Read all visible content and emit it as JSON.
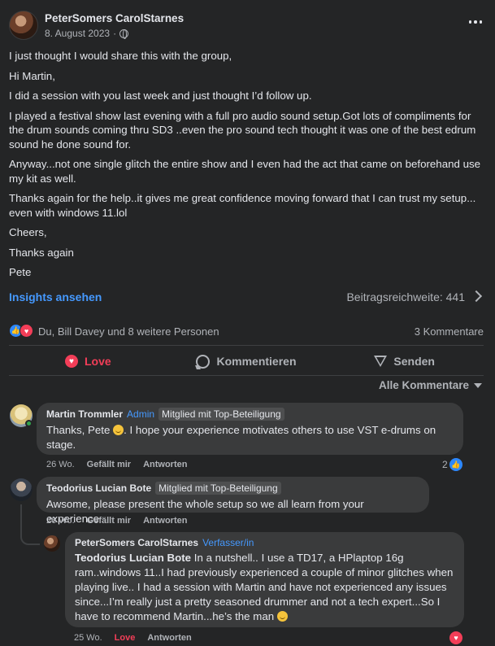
{
  "post": {
    "author": "PeterSomers CarolStarnes",
    "date": "8. August 2023",
    "date_sep": "·",
    "body": [
      "I just thought I would share this with the group,",
      "Hi Martin,",
      "I did a session with you last week and just thought I’d follow up.",
      "I played a festival show last evening with a full pro audio sound setup.Got lots of compliments for the drum sounds coming thru SD3 ..even the pro sound tech thought it was one of the best edrum sound he done sound for.",
      "Anyway...not one single glitch the entire show and I even had the act that came on beforehand use my kit as well.",
      "Thanks again for the help..it gives me great confidence moving forward that I can trust my setup... even with windows 11.lol",
      "Cheers,",
      "Thanks again",
      "Pete"
    ],
    "insights_label": "Insights ansehen",
    "reach_label": "Beitragsreichweite: 441",
    "reactions_text": "Du, Bill Davey und 8 weitere Personen",
    "comment_count": "3 Kommentare"
  },
  "actions": {
    "love": "Love",
    "comment": "Kommentieren",
    "send": "Senden"
  },
  "sort_label": "Alle Kommentare",
  "comments": [
    {
      "author": "Martin Trommler",
      "role": "Admin",
      "badge": "Mitglied mit Top-Beteiligung",
      "text_before": "Thanks, Pete",
      "text_after": ". I hope your experience motivates others to use VST e-drums on stage.",
      "time": "26 Wo.",
      "like": "Gefällt mir",
      "reply": "Antworten",
      "reaction_count": "2"
    },
    {
      "author": "Teodorius Lucian Bote",
      "badge": "Mitglied mit Top-Beteiligung",
      "text": "Awsome, please present the whole setup so we all learn from your experience",
      "time": "26 Wo.",
      "like": "Gefällt mir",
      "reply": "Antworten"
    },
    {
      "author": "PeterSomers CarolStarnes",
      "role": "Verfasser/in",
      "mention": "Teodorius Lucian Bote",
      "text": "In a nutshell.. I use a TD17, a HPlaptop 16g ram..windows 11..I had previously experienced a couple of minor glitches when playing live.. I had a session with Martin and have not experienced any issues since...I’m really just a pretty seasoned drummer and not a tech expert...So I have to recommend Martin...he’s the man",
      "time": "25 Wo.",
      "like": "Love",
      "reply": "Antworten"
    }
  ],
  "colors": {
    "background": "#242526",
    "bubble": "#3a3b3c",
    "accent_blue": "#4599ff",
    "love_red": "#f33e58"
  },
  "icons": [
    "more-icon",
    "globe-icon",
    "chevron-right-icon",
    "like-reaction-icon",
    "love-reaction-icon",
    "comment-icon",
    "send-icon",
    "dropdown-icon",
    "smile-emoji"
  ]
}
